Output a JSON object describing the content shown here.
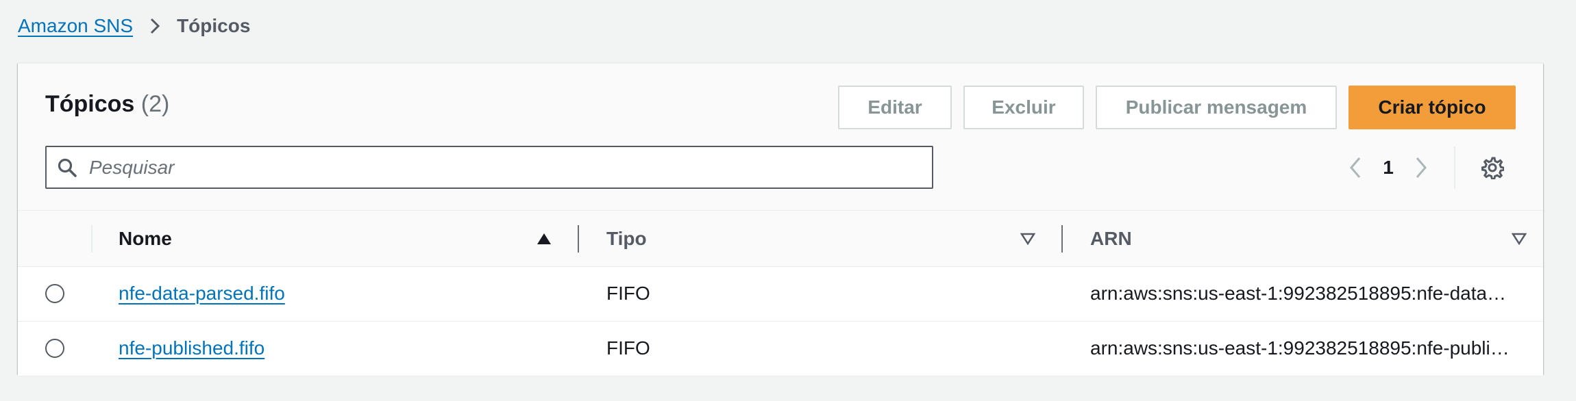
{
  "breadcrumb": {
    "root": "Amazon SNS",
    "current": "Tópicos"
  },
  "panel": {
    "title": "Tópicos",
    "count": "(2)"
  },
  "actions": {
    "edit": "Editar",
    "delete": "Excluir",
    "publish": "Publicar mensagem",
    "create": "Criar tópico"
  },
  "search": {
    "placeholder": "Pesquisar",
    "value": ""
  },
  "pagination": {
    "current_page": "1"
  },
  "table": {
    "columns": {
      "name": "Nome",
      "type": "Tipo",
      "arn": "ARN"
    },
    "rows": [
      {
        "name": "nfe-data-parsed.fifo",
        "type": "FIFO",
        "arn": "arn:aws:sns:us-east-1:992382518895:nfe-data…"
      },
      {
        "name": "nfe-published.fifo",
        "type": "FIFO",
        "arn": "arn:aws:sns:us-east-1:992382518895:nfe-publi…"
      }
    ]
  },
  "colors": {
    "link": "#0073bb",
    "primary_button": "#f29d3a",
    "background": "#f2f3f3"
  }
}
